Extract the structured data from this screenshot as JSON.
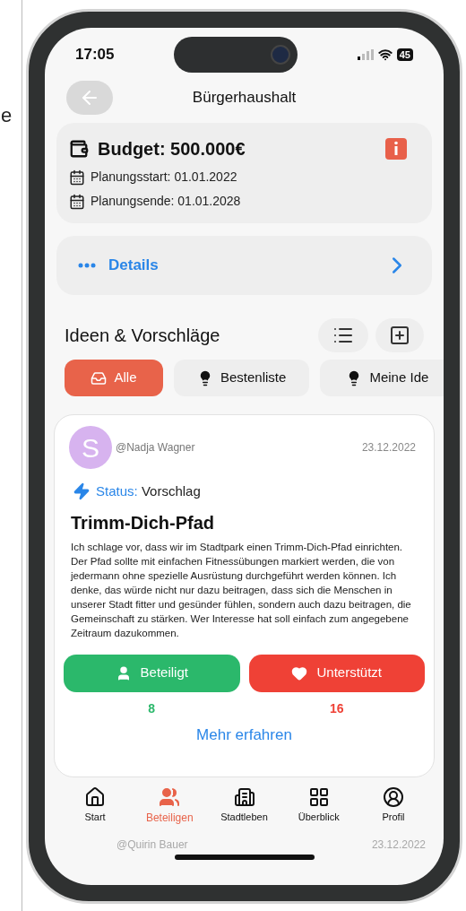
{
  "margin_text": "e",
  "status_bar": {
    "time": "17:05",
    "battery": "45"
  },
  "header": {
    "title": "Bürgerhaushalt"
  },
  "budget": {
    "title": "Budget: 500.000€",
    "dates": [
      "Planungsstart: 01.01.2022",
      "Planungsende: 01.01.2028"
    ]
  },
  "details": {
    "label": "Details"
  },
  "section": {
    "title": "Ideen & Vorschläge"
  },
  "filter_tabs": [
    {
      "label": "Alle",
      "kind": "all",
      "selected": true
    },
    {
      "label": "Bestenliste",
      "kind": "best",
      "selected": false
    },
    {
      "label": "Meine Ide",
      "kind": "mine",
      "selected": false
    }
  ],
  "post": {
    "avatar_letter": "S",
    "author": "@Nadja Wagner",
    "date": "23.12.2022",
    "status_label": "Status:",
    "status": "Vorschlag",
    "title": "Trimm-Dich-Pfad",
    "body": "Ich schlage vor, dass wir im Stadtpark einen Trimm-Dich-Pfad einrichten. Der Pfad sollte mit einfachen Fitnessübungen markiert werden, die von jedermann ohne spezielle Ausrüstung durchgeführt werden können. Ich denke, das würde nicht nur dazu beitragen, dass sich die Menschen in unserer Stadt fitter und gesünder fühlen, sondern auch dazu beitragen, die Gemeinschaft zu stärken. Wer Interesse hat soll einfach zum angegebene Zeitraum dazukommen.",
    "actions": [
      {
        "label": "Beteiligt",
        "kind": "participate",
        "count": "8"
      },
      {
        "label": "Unterstützt",
        "kind": "support",
        "count": "16"
      }
    ],
    "more": "Mehr erfahren"
  },
  "nav": [
    {
      "label": "Start",
      "kind": "home",
      "selected": false
    },
    {
      "label": "Beteiligen",
      "kind": "people",
      "selected": true
    },
    {
      "label": "Stadtleben",
      "kind": "city",
      "selected": false
    },
    {
      "label": "Überblick",
      "kind": "overview",
      "selected": false
    },
    {
      "label": "Profil",
      "kind": "profile",
      "selected": false
    }
  ],
  "next_post_preview": {
    "author": "@Quirin Bauer",
    "date": "23.12.2022"
  }
}
